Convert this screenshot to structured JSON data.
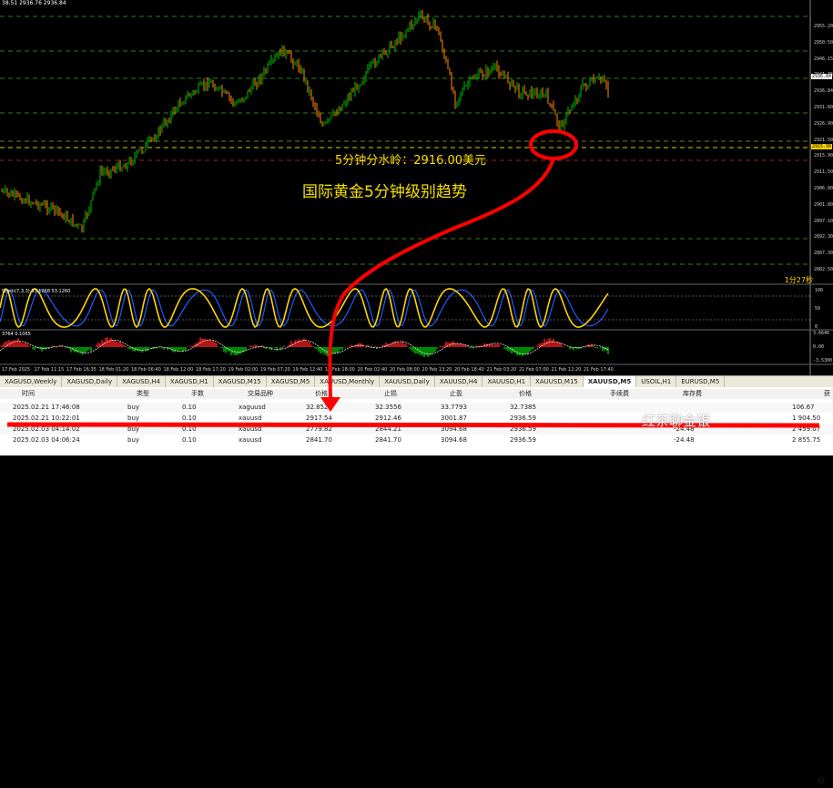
{
  "top_info": "38.51 2936.76 2936.84",
  "annotation_level": "5分钟分水岭：2916.00美元",
  "annotation_title": "国际黄金5分钟级别趋势",
  "countdown": "1分27秒",
  "stoch_label": "Stoch(7,3,3) 93.1268 53.1260",
  "macd_label": "3764 0.1065",
  "price_axis": [
    "2955.20",
    "2950.50",
    "2946.15",
    "2941.35",
    "2936.84",
    "2931.60",
    "2926.90",
    "2921.50",
    "2915.90",
    "2911.50",
    "2906.80",
    "2901.80",
    "2897.10",
    "2892.30",
    "2887.30",
    "2882.50"
  ],
  "current_price": "2936.84",
  "level_price": "2915.90",
  "stoch_axis": [
    "100",
    "50",
    "0"
  ],
  "macd_axis": [
    "3.6646",
    "0.00",
    "-3.5300"
  ],
  "time_axis": [
    "17 Feb 2025",
    "17 Feb 11:15",
    "17 Feb 16:35",
    "18 Feb 01:20",
    "18 Feb 06:40",
    "18 Feb 12:00",
    "18 Feb 17:20",
    "19 Feb 02:00",
    "19 Feb 07:20",
    "19 Feb 12:40",
    "19 Feb 18:00",
    "20 Feb 02:40",
    "20 Feb 08:00",
    "20 Feb 13:20",
    "20 Feb 18:40",
    "21 Feb 03:20",
    "21 Feb 07:00",
    "21 Feb 12:20",
    "21 Feb 17:40"
  ],
  "tabs": [
    "XAGUSD,Weekly",
    "XAGUSD,Daily",
    "XAGUSD,H4",
    "XAGUSD,H1",
    "XAGUSD,M15",
    "XAGUSD,M5",
    "XAUUSD,Monthly",
    "XAUUSD,Daily",
    "XAUUSD,H4",
    "XAUUSD,H1",
    "XAUUSD,M15",
    "XAUUSD,M5",
    "USOIL,H1",
    "EURUSD,M5"
  ],
  "active_tab": "XAUUSD,M5",
  "table": {
    "headers": [
      "时间",
      "类型",
      "手数",
      "交易品种",
      "价格",
      "止损",
      "止盈",
      "价格",
      "手续费",
      "库存费",
      "获"
    ],
    "rows": [
      [
        "2025.02.21 17:46:08",
        "buy",
        "0.10",
        "xaguusd",
        "32.8525",
        "32.3556",
        "33.7793",
        "32.7385",
        "",
        "",
        "106.67"
      ],
      [
        "2025.02.21 10:22:01",
        "buy",
        "0.10",
        "xauusd",
        "2917.54",
        "2912.46",
        "3001.87",
        "2936.59",
        "",
        "",
        "1 904.50"
      ],
      [
        "2025.02.03 04:14:02",
        "buy",
        "0.10",
        "xauusd",
        "2779.82",
        "2844.21",
        "3094.68",
        "2936.59",
        "",
        "-24.48",
        "2 459.07"
      ],
      [
        "2025.02.03 04:06:24",
        "buy",
        "0.10",
        "xauusd",
        "2841.70",
        "2841.70",
        "3094.68",
        "2936.59",
        "",
        "-24.48",
        "2 855.75"
      ]
    ]
  },
  "watermark": "红茶聊金银",
  "colors": {
    "bull": "#00c000",
    "bear": "#ff8c00",
    "annotation": "#f5e000",
    "arrow": "#ff0000",
    "stoch_main": "#ffd400",
    "stoch_signal": "#1e5cff"
  }
}
